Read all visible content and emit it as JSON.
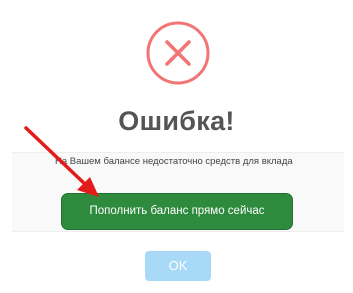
{
  "dialog": {
    "title": "Ошибка!",
    "message": "На Вашем балансе недостаточно средств для вклада",
    "topup_label": "Пополнить баланс прямо сейчас",
    "ok_label": "OK",
    "icon": "error-x-circle-icon"
  },
  "annotation": {
    "icon": "red-arrow-icon"
  },
  "colors": {
    "error_red": "#f27474",
    "topup_green": "#2e8b3d",
    "ok_blue": "#a8d9f7",
    "arrow_red": "#e41b1b"
  }
}
